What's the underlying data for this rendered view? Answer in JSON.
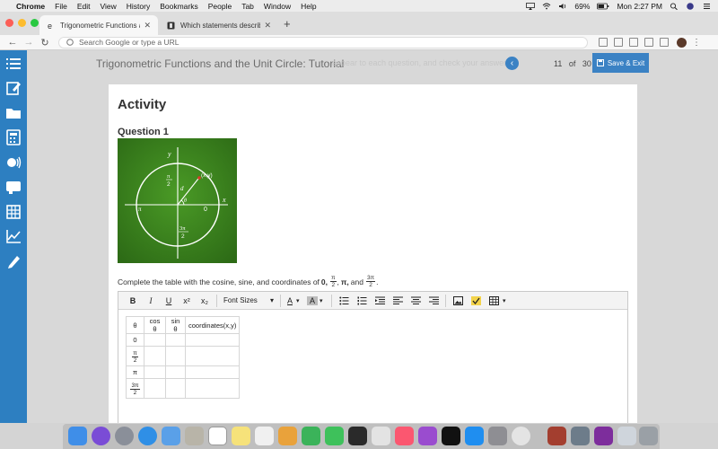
{
  "menubar": {
    "app": "Chrome",
    "items": [
      "File",
      "Edit",
      "View",
      "History",
      "Bookmarks",
      "People",
      "Tab",
      "Window",
      "Help"
    ],
    "battery": "69%",
    "clock": "Mon 2:27 PM"
  },
  "tabs": [
    {
      "title": "Trigonometric Functions and the",
      "active": true
    },
    {
      "title": "Which statements describe wa",
      "active": false
    }
  ],
  "address": {
    "placeholder": "Search Google or type a URL"
  },
  "header": {
    "lesson_title": "Trigonometric Functions and the Unit Circle: Tutorial",
    "ghost_text": "appear to each question, and check your answer",
    "page_current": "11",
    "page_of": "of",
    "page_total": "30",
    "save_label": "Save & Exit"
  },
  "activity": {
    "title": "Activity",
    "question_title": "Question 1",
    "figure": {
      "y_label": "y",
      "x_label": "x",
      "point_label": "(x,y)",
      "radius_label": "d",
      "angle_label": "θ",
      "zero_label": "0",
      "left_label": "π",
      "top_num": "π",
      "top_den": "2",
      "bottom_num": "3π",
      "bottom_den": "2"
    },
    "instruction_prefix": "Complete the table with the cosine, sine, and coordinates of",
    "instruction_zero": "0,",
    "instruction_f1_num": "π",
    "instruction_f1_den": "2",
    "instruction_comma1": ",",
    "instruction_pi": "π,",
    "instruction_and": "and",
    "instruction_f2_num": "3π",
    "instruction_f2_den": "2",
    "instruction_end": "."
  },
  "editor": {
    "bold": "B",
    "italic": "I",
    "underline": "U",
    "superscript": "x²",
    "subscript": "x₂",
    "font_sizes": "Font Sizes",
    "dropdown_arrow": "▾",
    "text_color": "A",
    "highlight": "A"
  },
  "table": {
    "headers": [
      "θ",
      "cos θ",
      "sin θ",
      "coordinates(x,y)"
    ],
    "rows": [
      {
        "theta": "0"
      },
      {
        "theta_num": "π",
        "theta_den": "2"
      },
      {
        "theta": "π"
      },
      {
        "theta_num": "3π",
        "theta_den": "2"
      }
    ]
  },
  "colors": {
    "sidebar": "#2d7fc1",
    "accent": "#3b82c4",
    "figure_green": "#3f8a22"
  }
}
